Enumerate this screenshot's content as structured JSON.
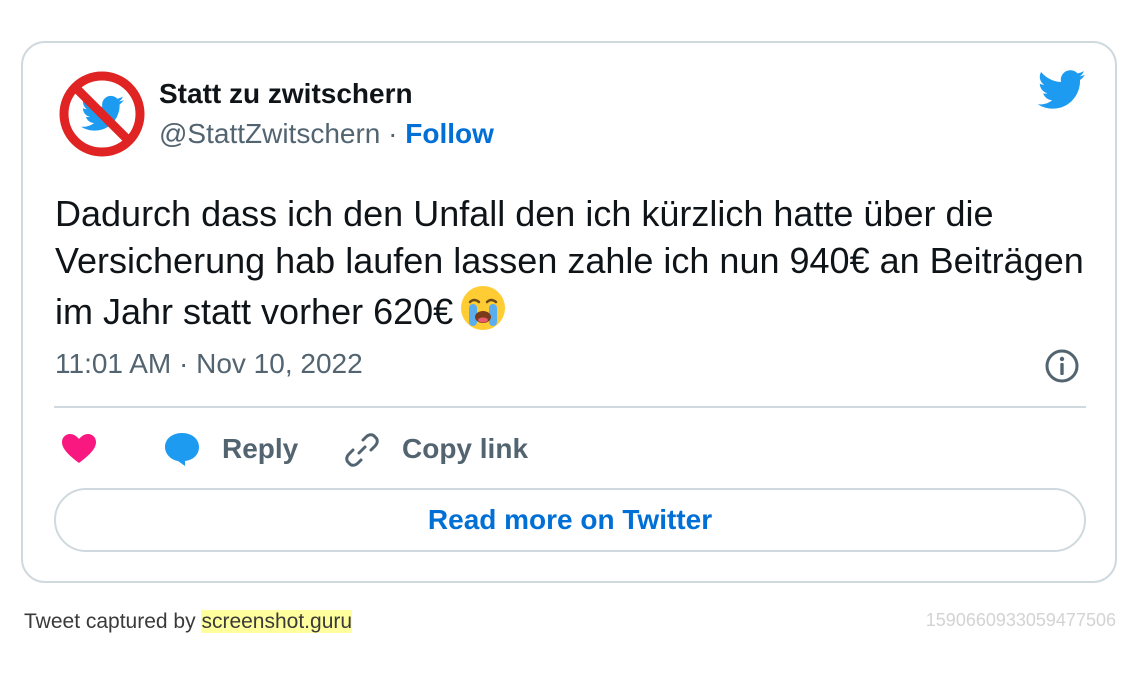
{
  "author": {
    "name": "Statt zu zwitschern",
    "handle": "@StattZwitschern",
    "separator": "·",
    "follow_label": "Follow",
    "avatar_icon": "crossed-out-bird-icon"
  },
  "brand_icon": "twitter-bird-icon",
  "tweet": {
    "text": "Dadurch dass ich den Unfall den ich kürzlich hatte über die Versicherung hab laufen lassen zahle ich nun 940€ an Beiträgen im Jahr statt vorher 620€",
    "emoji": "loudly-crying-face-icon",
    "timestamp": "11:01 AM · Nov 10, 2022"
  },
  "actions": {
    "like_icon": "heart-icon",
    "reply_label": "Reply",
    "copy_label": "Copy link"
  },
  "read_more_label": "Read more on Twitter",
  "footer": {
    "captured_prefix": "Tweet captured by",
    "captured_site": "screenshot.guru",
    "tweet_id": "1590660933059477506"
  },
  "colors": {
    "link_blue": "#006fd6",
    "twitter_blue": "#1d9bf0",
    "heart_pink": "#f91880",
    "muted_text": "#536471",
    "border": "#cfd9de",
    "highlight": "#ffff9e"
  }
}
